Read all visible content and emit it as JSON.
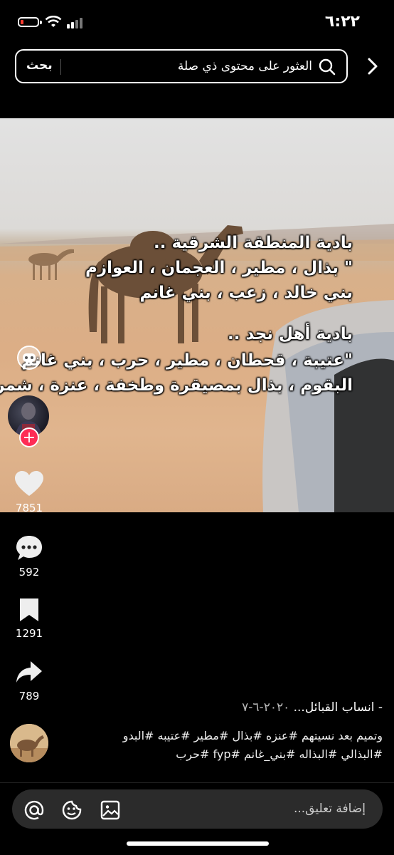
{
  "status_bar": {
    "time": "٦:٢٢",
    "battery_level": 0.1,
    "battery_color": "#ff3b30"
  },
  "search": {
    "button_label": "بحث",
    "placeholder": "العثور على محتوى ذي صلة"
  },
  "video": {
    "overlay_lines": [
      "بادية المنطقة الشرقية ..",
      "\" بذال ، مطير ، العجمان ، العوازم",
      "بني خالد ، زعب ، بني غانم",
      "بادية أهل نجد ..",
      "\"عتيبة ، قحطان ، مطير ، حرب ، بني غانم",
      "البقوم ، بذال بمصيقرة وطخفة ، عنزة ، شمر \""
    ]
  },
  "actions": {
    "likes": "7851",
    "comments": "592",
    "saves": "1291",
    "shares": "789"
  },
  "caption": {
    "title": "- انساب القبائل...",
    "date": "٢٠٢٠-٦-٧",
    "hashtags_line1": "وتميم بعد نسيتهم #عنزه #بذال #مطير #عتيبه #البدو",
    "hashtags_line2": "#البذالي #البذاله #بني_غانم #fyp #حرب"
  },
  "comment": {
    "placeholder": "إضافة تعليق..."
  },
  "colors": {
    "accent": "#fe2c55",
    "background": "#000000"
  }
}
